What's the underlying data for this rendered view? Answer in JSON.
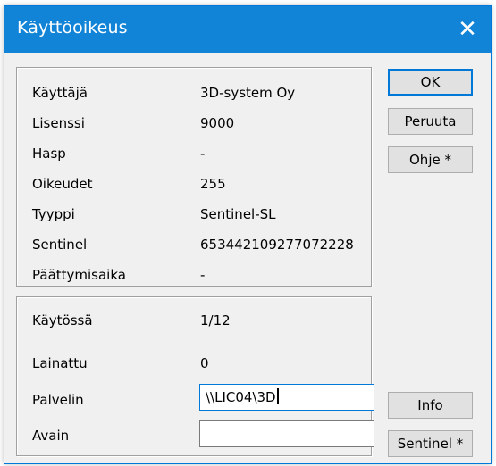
{
  "window": {
    "title": "Käyttöoikeus",
    "close_glyph": "✕"
  },
  "license_info": [
    {
      "label": "Käyttäjä",
      "value": "3D-system Oy"
    },
    {
      "label": "Lisenssi",
      "value": "9000"
    },
    {
      "label": "Hasp",
      "value": "-"
    },
    {
      "label": "Oikeudet",
      "value": "255"
    },
    {
      "label": "Tyyppi",
      "value": "Sentinel-SL"
    },
    {
      "label": "Sentinel",
      "value": "65344210927707222 8"
    },
    {
      "label": "Päättymisaika",
      "value": "-"
    }
  ],
  "usage": {
    "in_use_label": "Käytössä",
    "in_use_value": "1/12",
    "borrowed_label": "Lainattu",
    "borrowed_value": "0",
    "server_label": "Palvelin",
    "server_value": "\\\\LIC04\\3D",
    "key_label": "Avain",
    "key_value": ""
  },
  "buttons": {
    "ok": "OK",
    "cancel": "Peruuta",
    "help": "Ohje *",
    "info": "Info",
    "sentinel": "Sentinel *"
  },
  "colors": {
    "titlebar": "#1284d7",
    "focus": "#0078d7"
  }
}
